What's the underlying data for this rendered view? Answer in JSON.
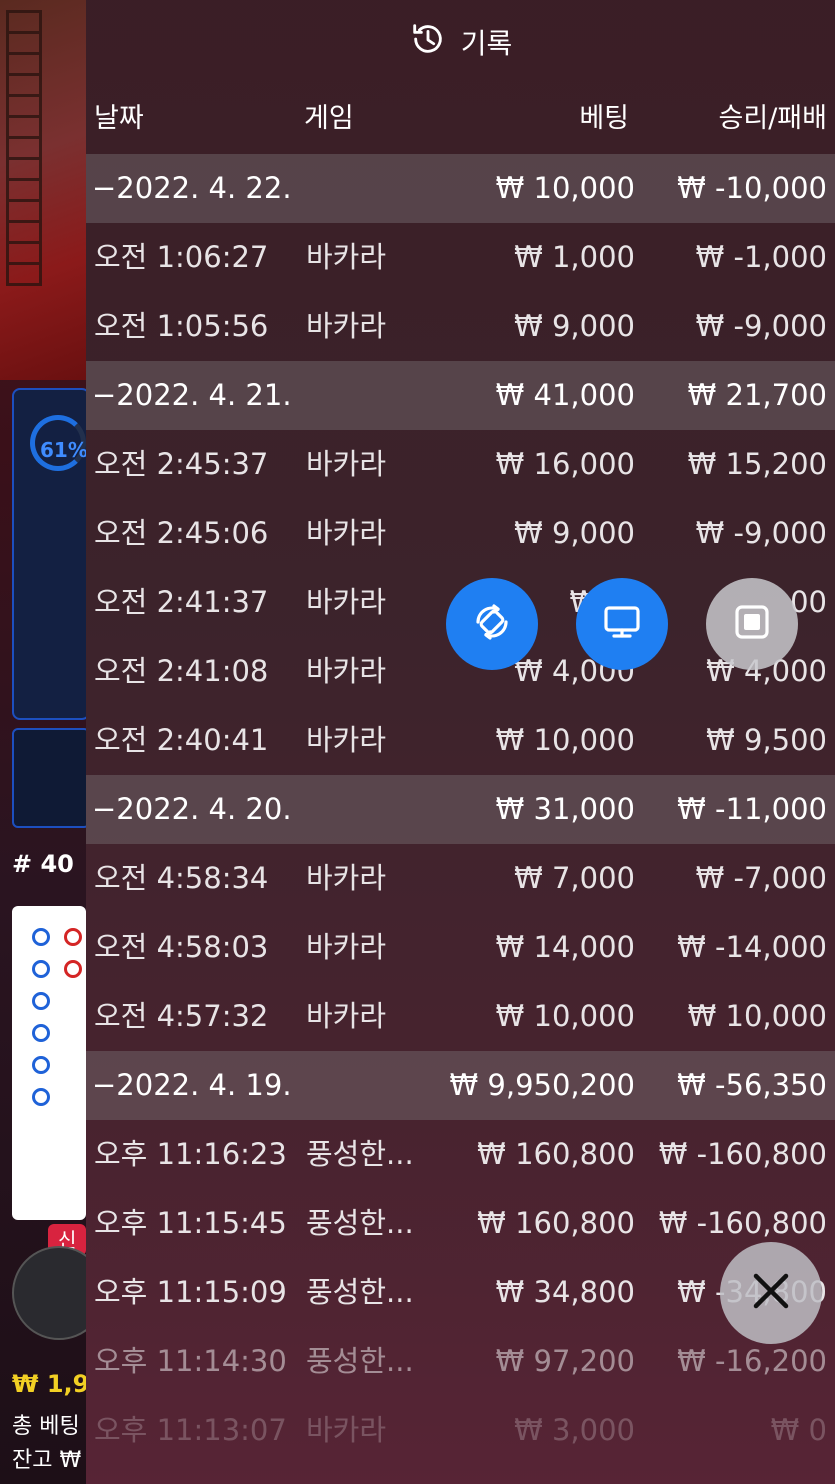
{
  "background": {
    "percent": "61%",
    "round": "# 40",
    "badge": "신규",
    "balance": "₩ 1,9",
    "total_bet": "총 베팅",
    "jan": "잔고 ₩"
  },
  "panel": {
    "title": "기록",
    "columns": {
      "date": "날짜",
      "game": "게임",
      "bet": "베팅",
      "winloss": "승리/패배"
    },
    "rows": [
      {
        "kind": "group",
        "date": "−2022. 4. 22.",
        "game": "",
        "bet": "₩ 10,000",
        "winloss": "₩ -10,000"
      },
      {
        "kind": "item",
        "date": "오전 1:06:27",
        "game": "바카라",
        "bet": "₩ 1,000",
        "winloss": "₩ -1,000"
      },
      {
        "kind": "item",
        "date": "오전 1:05:56",
        "game": "바카라",
        "bet": "₩ 9,000",
        "winloss": "₩ -9,000"
      },
      {
        "kind": "group",
        "date": "−2022. 4. 21.",
        "game": "",
        "bet": "₩ 41,000",
        "winloss": "₩ 21,700"
      },
      {
        "kind": "item",
        "date": "오전 2:45:37",
        "game": "바카라",
        "bet": "₩ 16,000",
        "winloss": "₩ 15,200"
      },
      {
        "kind": "item",
        "date": "오전 2:45:06",
        "game": "바카라",
        "bet": "₩ 9,000",
        "winloss": "₩ -9,000"
      },
      {
        "kind": "item",
        "date": "오전 2:41:37",
        "game": "바카라",
        "bet": "₩ 2,",
        "winloss": "00"
      },
      {
        "kind": "item",
        "date": "오전 2:41:08",
        "game": "바카라",
        "bet": "₩ 4,000",
        "winloss": "₩ 4,000"
      },
      {
        "kind": "item",
        "date": "오전 2:40:41",
        "game": "바카라",
        "bet": "₩ 10,000",
        "winloss": "₩ 9,500"
      },
      {
        "kind": "group",
        "date": "−2022. 4. 20.",
        "game": "",
        "bet": "₩ 31,000",
        "winloss": "₩ -11,000"
      },
      {
        "kind": "item",
        "date": "오전 4:58:34",
        "game": "바카라",
        "bet": "₩ 7,000",
        "winloss": "₩ -7,000"
      },
      {
        "kind": "item",
        "date": "오전 4:58:03",
        "game": "바카라",
        "bet": "₩ 14,000",
        "winloss": "₩ -14,000"
      },
      {
        "kind": "item",
        "date": "오전 4:57:32",
        "game": "바카라",
        "bet": "₩ 10,000",
        "winloss": "₩ 10,000"
      },
      {
        "kind": "group",
        "date": "−2022. 4. 19.",
        "game": "",
        "bet": "₩ 9,950,200",
        "winloss": "₩ -56,350"
      },
      {
        "kind": "item",
        "date": "오후 11:16:23",
        "game": "풍성한...",
        "bet": "₩ 160,800",
        "winloss": "₩ -160,800"
      },
      {
        "kind": "item",
        "date": "오후 11:15:45",
        "game": "풍성한...",
        "bet": "₩ 160,800",
        "winloss": "₩ -160,800"
      },
      {
        "kind": "item",
        "date": "오후 11:15:09",
        "game": "풍성한...",
        "bet": "₩ 34,800",
        "winloss": "₩ -34,800"
      },
      {
        "kind": "item",
        "date": "오후 11:14:30",
        "game": "풍성한...",
        "bet": "₩ 97,200",
        "winloss": "₩ -16,200",
        "fade": "1"
      },
      {
        "kind": "item",
        "date": "오후 11:13:07",
        "game": "바카라",
        "bet": "₩ 3,000",
        "winloss": "₩ 0",
        "fade": "2"
      }
    ]
  },
  "icons": {
    "header": "history-clock-icon",
    "rotate": "rotate-screen-icon",
    "monitor": "monitor-icon",
    "square": "stop-square-icon",
    "close": "close-icon"
  },
  "colors": {
    "accent": "#1f7ff2",
    "balance": "#f2d024",
    "badge": "#d8233f"
  }
}
